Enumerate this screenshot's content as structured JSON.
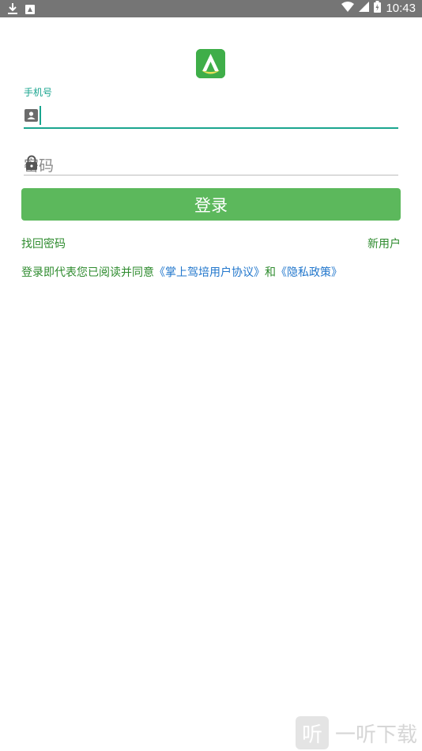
{
  "status_bar": {
    "time": "10:43",
    "icons": [
      "download-icon",
      "app-notification-icon",
      "wifi-icon",
      "signal-icon",
      "battery-icon"
    ]
  },
  "login": {
    "phone_label": "手机号",
    "phone_value": "",
    "password_placeholder": "密码",
    "login_button": "登录",
    "forgot_password": "找回密码",
    "new_user": "新用户",
    "agreement": {
      "prefix": "登录即代表您已阅读并同意",
      "user_agreement": "《掌上驾培用户协议》",
      "conjunction": "和",
      "privacy_policy": "《隐私政策》"
    }
  },
  "watermark": {
    "box": "听",
    "text": "一听下载"
  },
  "colors": {
    "status_bar": "#757575",
    "accent": "#1aa58f",
    "button": "#5cb85c",
    "link_green": "#2e8b2e",
    "link_blue": "#2277cc"
  }
}
